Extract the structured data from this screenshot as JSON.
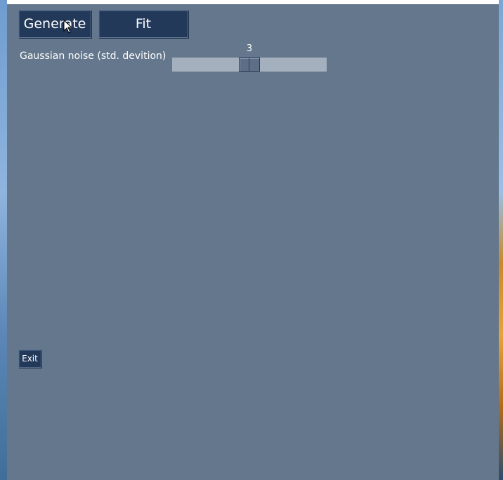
{
  "controls": {
    "generate_label": "Generate",
    "fit_label": "Fit",
    "exit_label": "Exit"
  },
  "noise": {
    "label": "Gaussian noise (std. devition)",
    "value": "3",
    "level": 0.5
  },
  "colors": {
    "window_bg": "#64778c",
    "button_bg": "#23395a",
    "slider_track": "#a4b0bd",
    "slider_thumb": "#5d6f86",
    "text": "#ffffff"
  },
  "icons": {
    "cursor": "mouse-pointer-icon"
  }
}
